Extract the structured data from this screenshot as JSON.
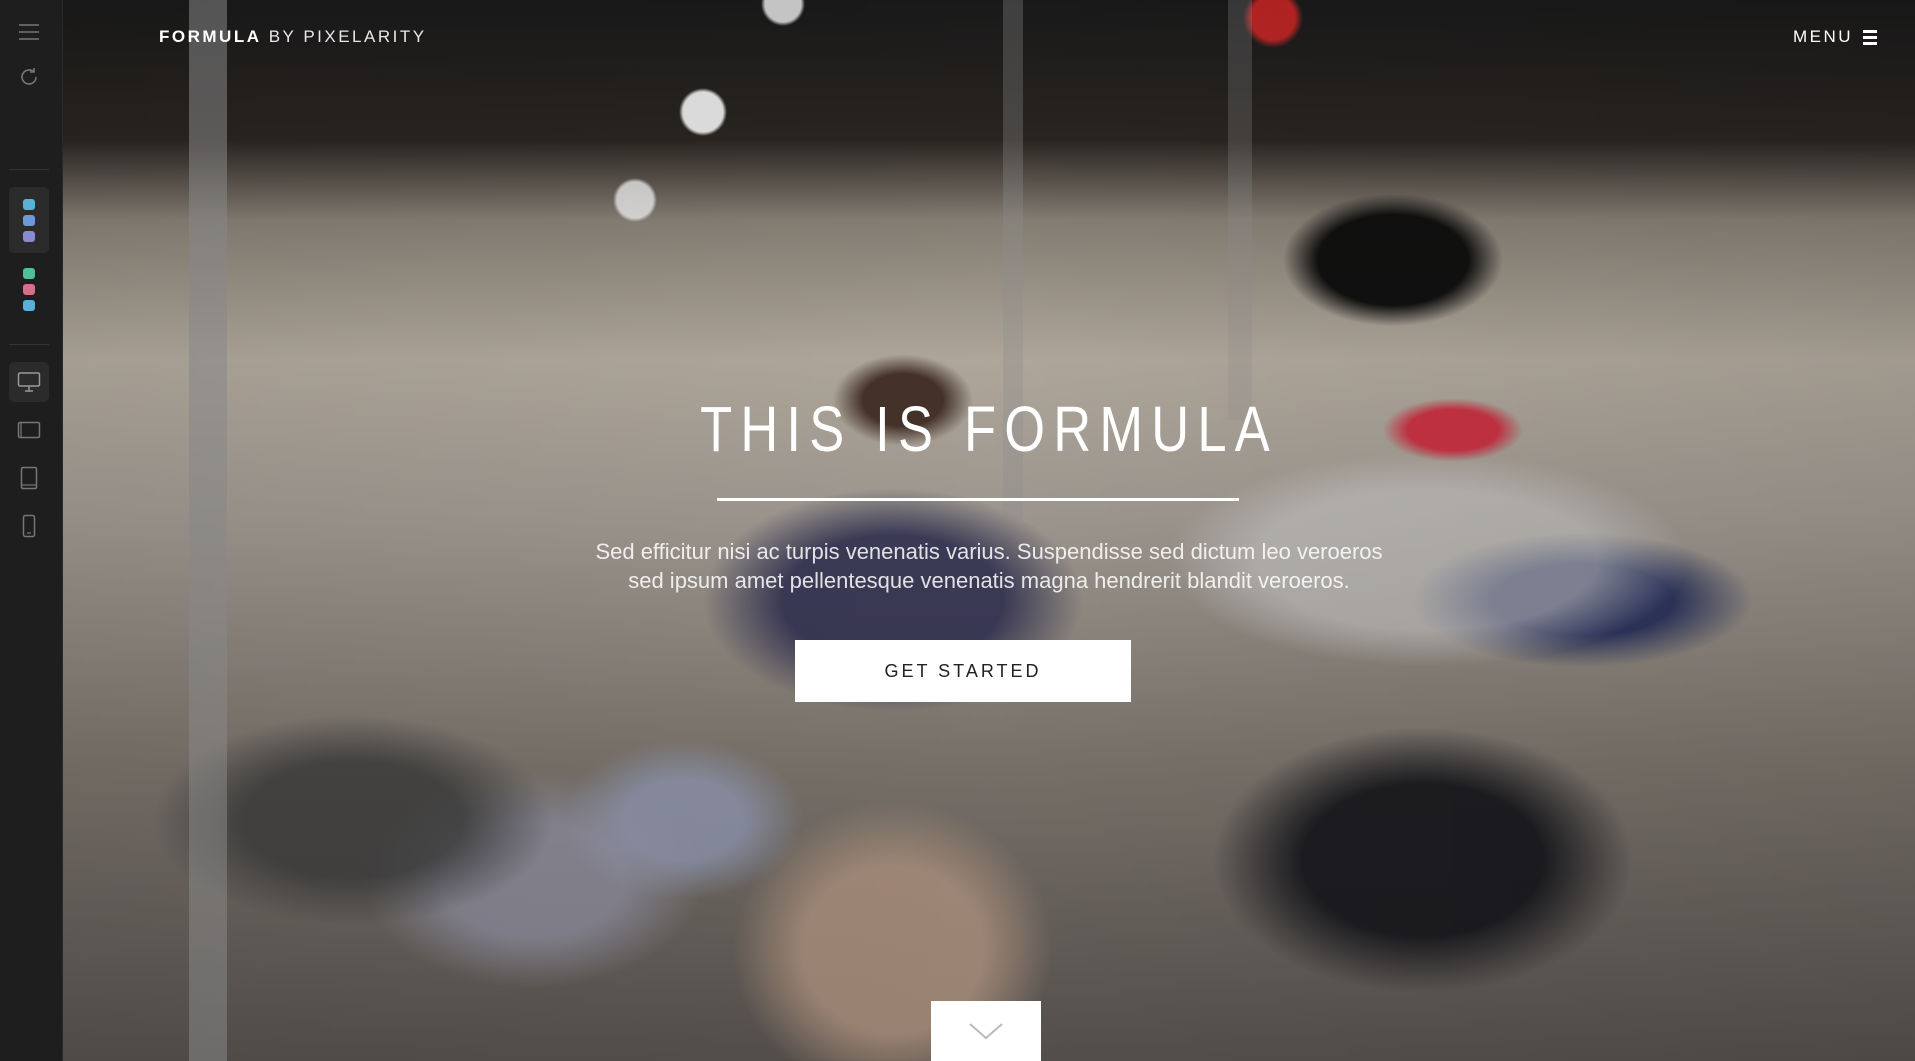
{
  "toolbar": {
    "items": [
      {
        "icon": "hamburger-icon"
      },
      {
        "icon": "refresh-icon"
      },
      {
        "icon": "color-scheme-icon",
        "colors": [
          "#5bb0d8",
          "#6a9ad8",
          "#8a8ad0"
        ],
        "active": true
      },
      {
        "icon": "color-scheme-icon",
        "colors": [
          "#4fbf9a",
          "#d86f8a",
          "#5bb0d8"
        ],
        "active": false
      },
      {
        "icon": "desktop-icon",
        "active": true
      },
      {
        "icon": "tablet-landscape-icon"
      },
      {
        "icon": "tablet-portrait-icon"
      },
      {
        "icon": "mobile-icon"
      }
    ]
  },
  "header": {
    "brand_bold": "FORMULA",
    "brand_light": "BY PIXELARITY",
    "menu_label": "MENU"
  },
  "hero": {
    "title": "THIS IS FORMULA",
    "subtitle_line1": "Sed efficitur nisi ac turpis venenatis varius. Suspendisse sed dictum leo veroeros",
    "subtitle_line2": "sed ipsum amet pellentesque venenatis magna hendrerit blandit veroeros.",
    "cta_label": "GET STARTED",
    "scroll_icon": "chevron-down-icon"
  }
}
